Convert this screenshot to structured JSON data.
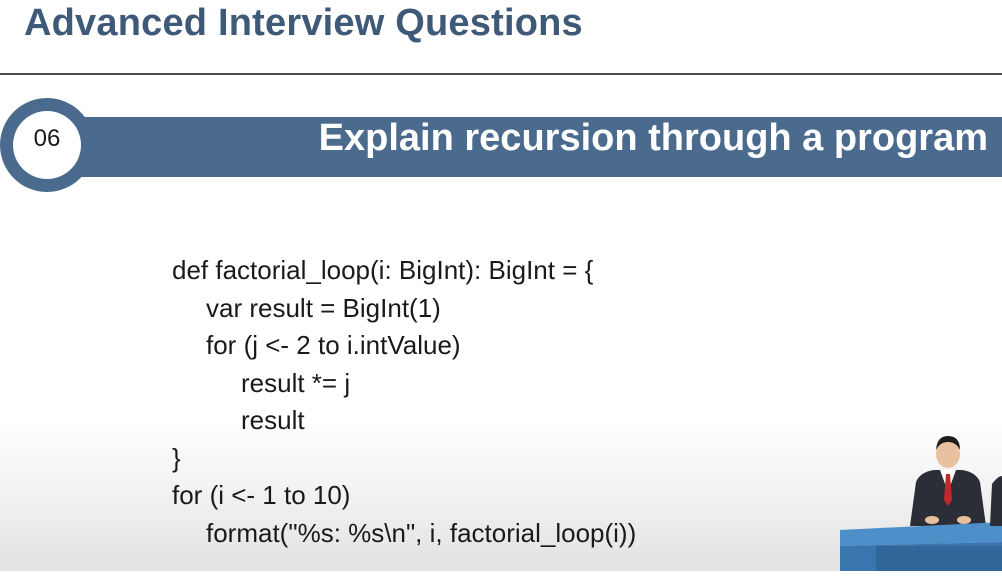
{
  "slide": {
    "title": "Advanced Interview Questions"
  },
  "question": {
    "number": "06",
    "title": "Explain recursion through a program"
  },
  "code": {
    "lines": [
      "def factorial_loop(i: BigInt): BigInt = {",
      "var result = BigInt(1)",
      "for (j <- 2 to i.intValue)",
      "result *= j",
      "result",
      "}",
      "for (i <- 1 to 10)",
      "format(\"%s: %s\\n\", i, factorial_loop(i))"
    ]
  },
  "colors": {
    "title_text": "#3f5a78",
    "banner": "#4a6a8e",
    "badge_ring": "#4a6a8e",
    "background": "#ffffff"
  },
  "icons": {
    "presenter": "presenter-at-desk-illustration"
  }
}
